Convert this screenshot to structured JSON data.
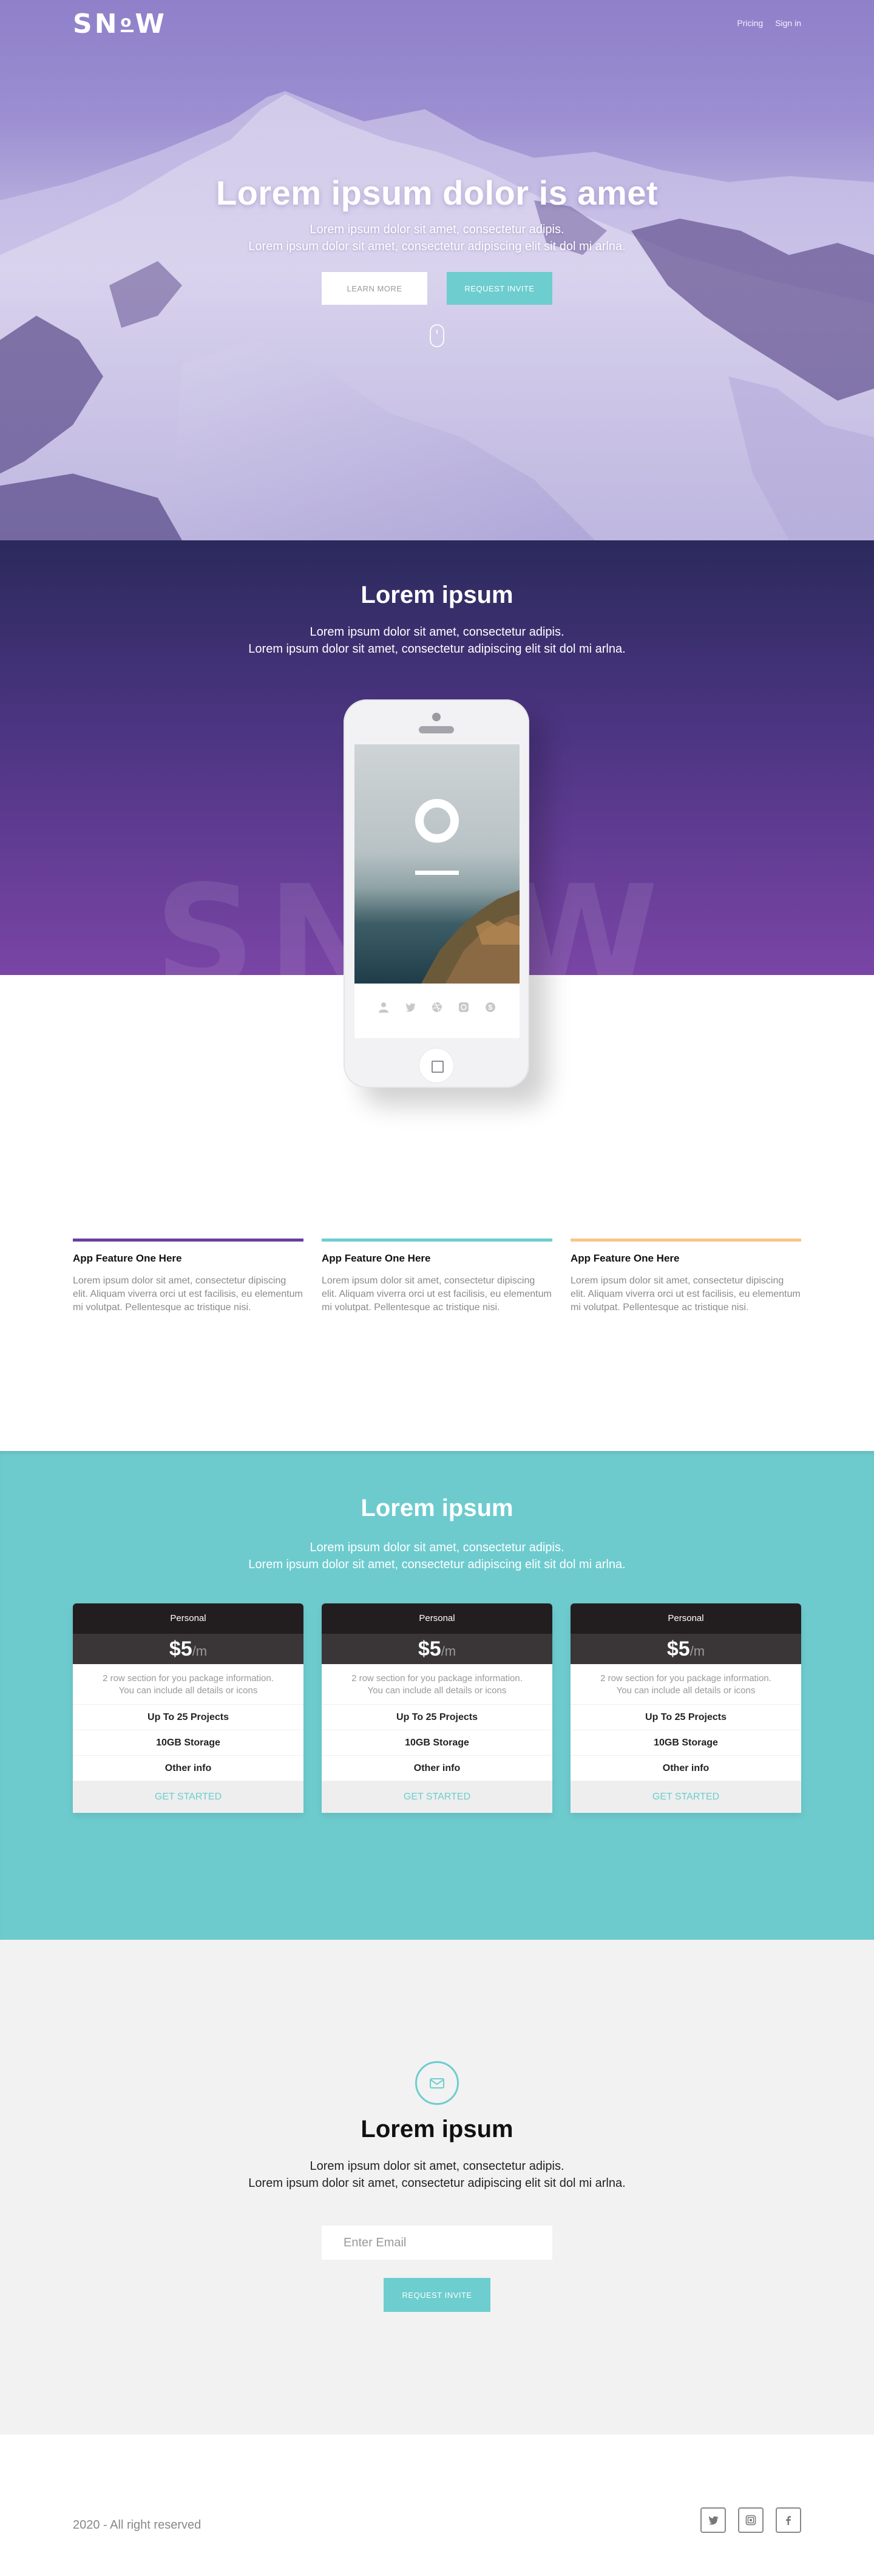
{
  "brand": {
    "logo_left": "SN",
    "logo_o": "o",
    "logo_right": "W"
  },
  "nav": {
    "pricing": "Pricing",
    "sign_in": "Sign in"
  },
  "hero": {
    "title": "Lorem ipsum dolor is amet",
    "subtitle_line1": "Lorem ipsum dolor sit amet, consectetur adipis.",
    "subtitle_line2": "Lorem ipsum dolor sit amet, consectetur adipiscing elit sit dol mi arlna.",
    "learn_more": "LEARN MORE",
    "request_invite": "REQUEST INVITE"
  },
  "app": {
    "title": "Lorem ipsum",
    "subtitle_line1": "Lorem ipsum dolor sit amet, consectetur adipis.",
    "subtitle_line2": "Lorem ipsum dolor sit amet, consectetur adipiscing elit sit dol mi arlna.",
    "watermark": "SNoW",
    "phone_icons": [
      "user-icon",
      "twitter-icon",
      "dribbble-icon",
      "instagram-icon",
      "skype-icon"
    ]
  },
  "features": [
    {
      "title": "App Feature One Here",
      "text": "Lorem ipsum dolor sit amet, consectetur dipiscing elit. Aliquam viverra orci ut est facilisis, eu elementum mi volutpat. Pellentesque ac tristique nisi.",
      "color": "#6a3fa0"
    },
    {
      "title": "App Feature One Here",
      "text": "Lorem ipsum dolor sit amet, consectetur dipiscing elit. Aliquam viverra orci ut est facilisis, eu elementum mi volutpat. Pellentesque ac tristique nisi.",
      "color": "#6dcdcf"
    },
    {
      "title": "App Feature One Here",
      "text": "Lorem ipsum dolor sit amet, consectetur dipiscing elit. Aliquam viverra orci ut est facilisis, eu elementum mi volutpat. Pellentesque ac tristique nisi.",
      "color": "#f6c68a"
    }
  ],
  "pricing": {
    "title": "Lorem ipsum",
    "subtitle_line1": "Lorem ipsum dolor sit amet, consectetur adipis.",
    "subtitle_line2": "Lorem ipsum dolor sit amet, consectetur adipiscing elit sit dol mi arlna.",
    "plans": [
      {
        "name": "Personal",
        "price": "$5",
        "per": "/m",
        "desc_line1": "2 row section for you package information.",
        "desc_line2": "You can include all details or icons",
        "rows": [
          "Up To 25 Projects",
          "10GB Storage",
          "Other info"
        ],
        "cta": "GET STARTED"
      },
      {
        "name": "Personal",
        "price": "$5",
        "per": "/m",
        "desc_line1": "2 row section for you package information.",
        "desc_line2": "You can include all details or icons",
        "rows": [
          "Up To 25 Projects",
          "10GB Storage",
          "Other info"
        ],
        "cta": "GET STARTED"
      },
      {
        "name": "Personal",
        "price": "$5",
        "per": "/m",
        "desc_line1": "2 row section for you package information.",
        "desc_line2": "You can include all details or icons",
        "rows": [
          "Up To 25 Projects",
          "10GB Storage",
          "Other info"
        ],
        "cta": "GET STARTED"
      }
    ]
  },
  "subscribe": {
    "title": "Lorem ipsum",
    "subtitle_line1": "Lorem ipsum dolor sit amet, consectetur adipis.",
    "subtitle_line2": "Lorem ipsum dolor sit amet, consectetur adipiscing elit sit dol mi arlna.",
    "email_placeholder": "Enter Email",
    "button": "REQUEST INVITE"
  },
  "footer": {
    "copyright": "2020  -  All right reserved",
    "socials": [
      "twitter-icon",
      "instagram-icon",
      "facebook-icon"
    ]
  },
  "colors": {
    "teal": "#6dcdcf",
    "purple": "#6a3fa0",
    "orange": "#f6c68a",
    "dark": "#221e20"
  }
}
